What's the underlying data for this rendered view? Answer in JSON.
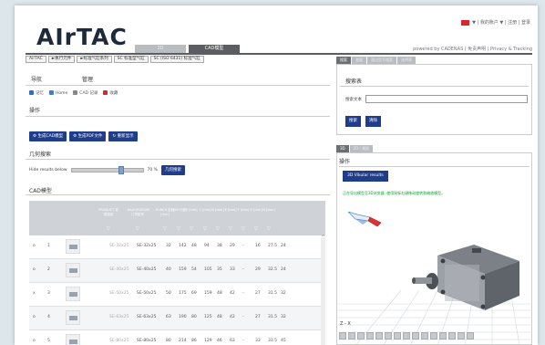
{
  "header": {
    "logo": "AIrTAC",
    "top_links": "▼ | 我的账户 ▼ | 注册 | 登录",
    "tabs": [
      "2D",
      "CAD模型"
    ],
    "active_tab": 1,
    "powered": "powered by CADENAS | 免责声明 | Privacy & Tracking"
  },
  "left": {
    "breadcrumbs": [
      "AirTAC",
      "►执行元件",
      "►标准气缸系列",
      "SC 标准型气缸",
      "SC (ISO 6431) 标准气缸"
    ],
    "nav_label": "导航",
    "manage_label": "管理",
    "icon_items": [
      "记忆",
      "Home",
      "CAD 记录",
      "收藏"
    ],
    "ops_title": "操作",
    "op_buttons": [
      "生成CAD模型",
      "生成PDF文件",
      "重新显示"
    ],
    "geo_title": "几何搜索",
    "filter_label": "Hide results below",
    "filter_percent": "70 %",
    "filter_value": 0.7,
    "filter_button": "几何搜索",
    "cad_title": "CAD模型"
  },
  "table": {
    "headers": [
      "PRODUCT\n变型描述",
      "BAUGROESSE\n订货型号",
      "DURCH\n缸径\n[mm]",
      "HUB\n行程",
      "B\n[mm]",
      "C\n[mm]",
      "D\n[mm]",
      "E\n[mm]",
      "F\n[mm]",
      "G\n[mm]",
      "H\n[mm]"
    ],
    "rows": [
      [
        "o",
        "1",
        "SE-32x25",
        "SE-32x25",
        "32",
        "142",
        "48",
        "94",
        "38",
        "29",
        "-",
        "16",
        "27.5",
        "24"
      ],
      [
        "o",
        "2",
        "SE-40x25",
        "SE-40x25",
        "40",
        "159",
        "54",
        "105",
        "35",
        "33",
        "-",
        "29",
        "32.5",
        "24"
      ],
      [
        "x",
        "3",
        "SE-50x25",
        "SE-50x25",
        "50",
        "175",
        "69",
        "159",
        "48",
        "42",
        "-",
        "27",
        "31.5",
        "32"
      ],
      [
        "o",
        "4",
        "SE-63x25",
        "SE-63x25",
        "63",
        "190",
        "80",
        "125",
        "48",
        "42",
        "-",
        "27",
        "31.5",
        "32"
      ],
      [
        "o",
        "5",
        "SE-80x25",
        "SE-80x25",
        "80",
        "214",
        "86",
        "129",
        "46",
        "63",
        "-",
        "33",
        "33.5",
        "45"
      ]
    ]
  },
  "right": {
    "top_tabs": [
      "搜索",
      "变量",
      "通过型号搜索",
      "选择表"
    ],
    "search_title": "搜索表",
    "search_label": "搜索文本",
    "search_placeholder": "",
    "search_buttons": [
      "搜索",
      "清除"
    ],
    "viewer_tabs": [
      "3D",
      "2D / 视图"
    ],
    "ops_title": "操作",
    "ar_button": "3D Vikular results",
    "notice": "正在导出模型至3D浏览器, 使用鼠标右键拖动旋转和缩放模型。",
    "axis": "Z - X"
  },
  "colors": {
    "accent": "#1f3d8a",
    "header_bar": "#5b5d62",
    "green": "#0a9b2a"
  }
}
